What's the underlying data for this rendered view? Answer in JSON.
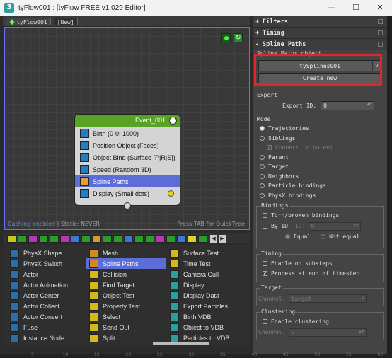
{
  "window": {
    "app_icon": "3",
    "title": "tyFlow001 : [tyFlow FREE v1.029 Editor]",
    "minimize": "—",
    "maximize": "☐",
    "close": "✕"
  },
  "tabs": [
    {
      "label": "tyFlow001",
      "arrow": "🡇"
    },
    {
      "label": "[New]"
    }
  ],
  "canvas": {
    "refresh_glyph": "↻",
    "status_cache": "Caching enabled",
    "status_sep": " | ",
    "status_static": "Static: NEVER",
    "hint": "Press TAB for QuickType"
  },
  "event": {
    "title": "Event_001",
    "operators": [
      {
        "label": "Birth (0-0: 1000)",
        "icon": "birth-icon",
        "color": "#1f7fc4"
      },
      {
        "label": "Position Object (Faces)",
        "icon": "position-object-icon",
        "color": "#1f7fc4"
      },
      {
        "label": "Object Bind (Surface [P|R|S])",
        "icon": "object-bind-icon",
        "color": "#1f7fc4"
      },
      {
        "label": "Speed (Random 3D)",
        "icon": "speed-icon",
        "color": "#1f7fc4"
      },
      {
        "label": "Spline Paths",
        "icon": "spline-paths-icon",
        "color": "#e0a030",
        "selected": true
      },
      {
        "label": "Display (Small dots)",
        "icon": "display-icon",
        "color": "#1f7fc4"
      }
    ]
  },
  "toolbar": {
    "nav_left": "◀",
    "nav_right": "▶",
    "icon_colors": [
      "#c8c81e",
      "#2a9e2a",
      "#b43ab4",
      "#2a9e2a",
      "#2a9e2a",
      "#b43ab4",
      "#3a7ad4",
      "#2a9e2a",
      "#d49e2a",
      "#2a9e2a",
      "#2a9e2a",
      "#3a7ad4",
      "#2a9e2a",
      "#2a9e2a",
      "#b43ab4",
      "#2a9e2a",
      "#3a7ad4",
      "#d4d42a",
      "#2a9e2a"
    ]
  },
  "palette": {
    "col1": [
      {
        "label": "PhysX Shape",
        "color": "#2b6fa8"
      },
      {
        "label": "PhysX Switch",
        "color": "#2b6fa8"
      },
      {
        "label": "Actor",
        "color": "#2b6fa8"
      },
      {
        "label": "Actor Animation",
        "color": "#2b6fa8"
      },
      {
        "label": "Actor Center",
        "color": "#2b6fa8"
      },
      {
        "label": "Actor Collect",
        "color": "#2b6fa8"
      },
      {
        "label": "Actor Convert",
        "color": "#2b6fa8"
      },
      {
        "label": "Fuse",
        "color": "#2b6fa8"
      },
      {
        "label": "Instance Node",
        "color": "#2b6fa8"
      }
    ],
    "col2": [
      {
        "label": "Mesh",
        "color": "#d48a1e"
      },
      {
        "label": "Spline Paths",
        "color": "#d48a1e",
        "selected": true
      },
      {
        "label": "Collision",
        "color": "#d4b81e"
      },
      {
        "label": "Find Target",
        "color": "#d4b81e"
      },
      {
        "label": "Object Test",
        "color": "#d4b81e"
      },
      {
        "label": "Property Test",
        "color": "#d4b81e"
      },
      {
        "label": "Select",
        "color": "#d4b81e"
      },
      {
        "label": "Send Out",
        "color": "#d4b81e"
      },
      {
        "label": "Split",
        "color": "#d4b81e"
      }
    ],
    "col3": [
      {
        "label": "Surface Test",
        "color": "#d4b81e"
      },
      {
        "label": "Time Test",
        "color": "#d4b81e"
      },
      {
        "label": "Camera Cull",
        "color": "#2b9e9e"
      },
      {
        "label": "Display",
        "color": "#2b9e9e"
      },
      {
        "label": "Display Data",
        "color": "#2b9e9e"
      },
      {
        "label": "Export Particles",
        "color": "#2b9e9e"
      },
      {
        "label": "Birth VDB",
        "color": "#2b9e9e"
      },
      {
        "label": "Object to VDB",
        "color": "#2b9e9e"
      },
      {
        "label": "Particles to VDB",
        "color": "#2b9e9e"
      }
    ]
  },
  "panel": {
    "rollouts": [
      "Filters",
      "Timing",
      "Spline Paths"
    ],
    "rollout_plus": "+",
    "rollout_minus": "-",
    "spline_group_label": "Spline Paths object",
    "spline_object": "tySplines001",
    "dropdown_arrow": "v",
    "create_new": "Create new",
    "export_label": "Export",
    "export_id_label": "Export ID:",
    "export_id_value": "0",
    "spin_arrows": "▲▼",
    "mode_label": "Mode",
    "modes": [
      {
        "label": "Trajectories",
        "on": true
      },
      {
        "label": "Siblings",
        "on": false
      }
    ],
    "connect_to_parent": "Connect to parent",
    "check_mark": "✔",
    "modes2": [
      "Parent",
      "Target",
      "Neighbors",
      "Particle bindings",
      "PhysX bindings"
    ],
    "bindings_label": "Bindings",
    "torn_bindings": "Torn/broken bindings",
    "by_id": "By ID",
    "id_label": "ID:",
    "id_value": "0",
    "equal": "Equal",
    "not_equal": "Not equal",
    "timing_label": "Timing",
    "enable_substeps": "Enable on substeps",
    "process_end": "Process at end of timestep",
    "target_label": "Target",
    "channel_label": "Channel:",
    "channel_value": "target",
    "clustering_label": "Clustering",
    "enable_clustering": "Enable clustering",
    "channel_value2": "0"
  },
  "ruler_ticks": [
    "5",
    "10",
    "15",
    "20",
    "25",
    "30",
    "35",
    "40",
    "45",
    "50",
    "55",
    "60"
  ]
}
